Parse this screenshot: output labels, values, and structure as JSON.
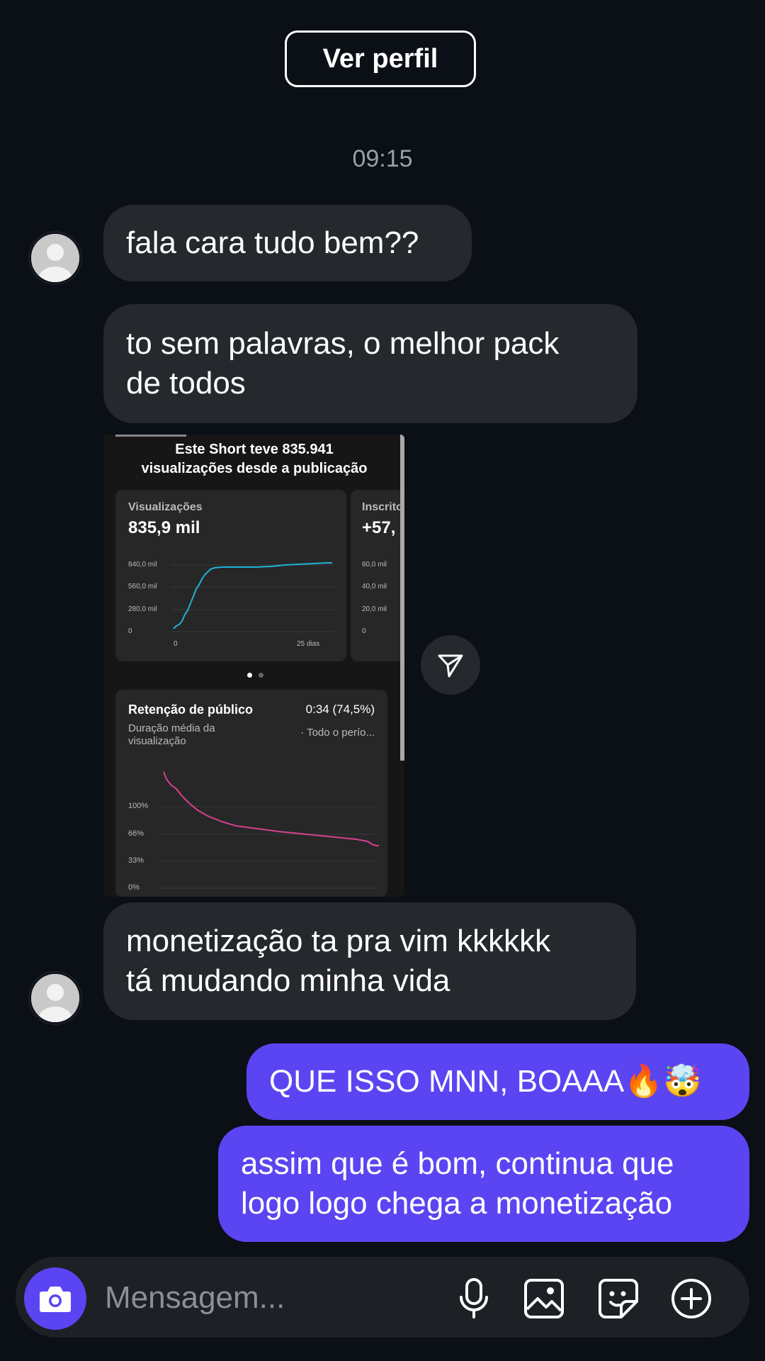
{
  "header": {
    "profile_button": "Ver perfil",
    "timestamp": "09:15"
  },
  "messages": {
    "m1": "fala cara tudo bem??",
    "m2_line1": "to sem palavras, o melhor pack",
    "m2_line2": "de todos",
    "m3_line1": "monetização ta pra vim kkkkkk",
    "m3_line2": "tá mudando minha vida",
    "m4": "QUE ISSO MNN, BOAAA🔥🤯",
    "m5_line1": "assim que é bom, continua que",
    "m5_line2": "logo logo chega a monetização"
  },
  "media": {
    "headline_line1": "Este Short teve 835.941",
    "headline_line2": "visualizações desde a publicação",
    "views_card": {
      "label": "Visualizações",
      "value": "835,9 mil",
      "y_ticks": [
        "840,0 mil",
        "560,0 mil",
        "280,0 mil",
        "0"
      ],
      "x_start": "0",
      "x_end": "25 dias"
    },
    "subs_card": {
      "label": "Inscrito",
      "value": "+57,",
      "y_ticks": [
        "60,0 mil",
        "40,0 mil",
        "20,0 mil",
        "0"
      ]
    },
    "retention_card": {
      "title": "Retenção de público",
      "value": "0:34 (74,5%)",
      "subtitle_line1": "Duração média da",
      "subtitle_line2": "visualização",
      "period": "· Todo o perío...",
      "y_ticks": [
        "100%",
        "66%",
        "33%",
        "0%"
      ]
    }
  },
  "composer": {
    "placeholder": "Mensagem..."
  },
  "colors": {
    "outgoing_bubble": "#5b45f2",
    "incoming_bubble": "#25282d",
    "views_line": "#1fb2d6",
    "retention_line": "#d6408f"
  },
  "icons": [
    "camera-icon",
    "microphone-icon",
    "gallery-icon",
    "sticker-icon",
    "plus-circle-icon",
    "send-icon",
    "avatar-icon"
  ]
}
